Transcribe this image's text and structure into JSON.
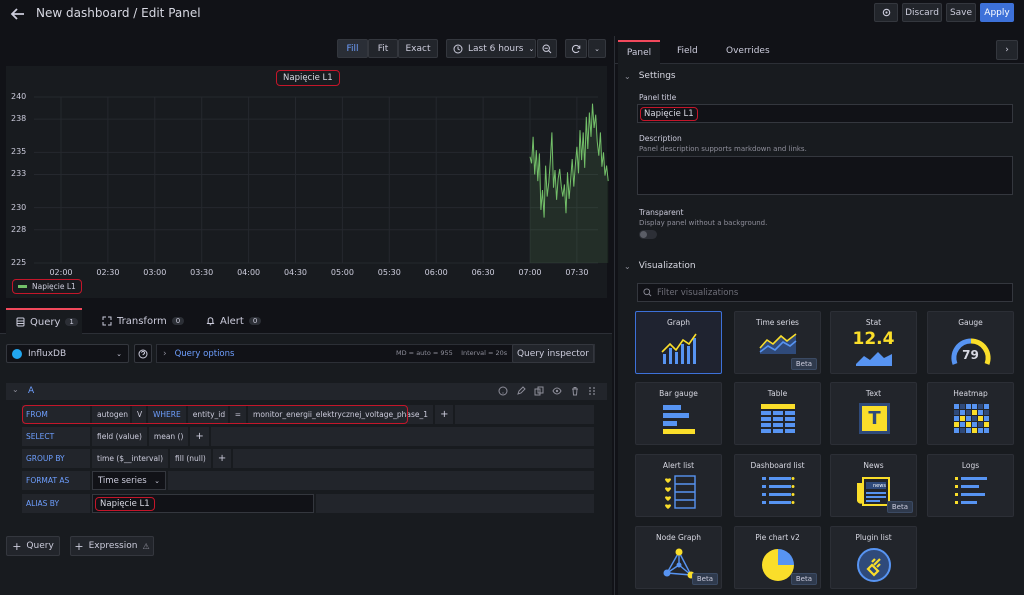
{
  "header": {
    "title": "New dashboard / Edit Panel",
    "discard": "Discard",
    "save": "Save",
    "apply": "Apply"
  },
  "toolbar": {
    "fill": "Fill",
    "fit": "Fit",
    "exact": "Exact",
    "time_range": "Last 6 hours"
  },
  "chart_data": {
    "type": "line",
    "title": "Napięcie L1",
    "yticks": [
      "240",
      "238",
      "235",
      "233",
      "230",
      "228",
      "225"
    ],
    "xticks": [
      "02:00",
      "02:30",
      "03:00",
      "03:30",
      "04:00",
      "04:30",
      "05:00",
      "05:30",
      "06:00",
      "06:30",
      "07:00",
      "07:30"
    ],
    "ylim": [
      225,
      240
    ],
    "legend_placement": "bottom-left",
    "series": [
      {
        "name": "Napięcie L1",
        "color": "#73bf69",
        "x": [
          "07:00",
          "07:01",
          "07:02",
          "07:03",
          "07:04",
          "07:05",
          "07:06",
          "07:07",
          "07:08",
          "07:09",
          "07:10",
          "07:11",
          "07:12",
          "07:13",
          "07:14",
          "07:15",
          "07:16",
          "07:17",
          "07:18",
          "07:19",
          "07:20",
          "07:21",
          "07:22",
          "07:23",
          "07:24",
          "07:25",
          "07:26",
          "07:27",
          "07:28",
          "07:29",
          "07:30",
          "07:31",
          "07:32",
          "07:33",
          "07:34",
          "07:35",
          "07:36",
          "07:37",
          "07:38",
          "07:39",
          "07:40",
          "07:41",
          "07:42",
          "07:43",
          "07:44",
          "07:45",
          "07:46",
          "07:47",
          "07:48",
          "07:49",
          "07:50"
        ],
        "y": [
          234.6,
          234.0,
          236.4,
          233.0,
          235.2,
          232.4,
          234.9,
          229.8,
          231.6,
          229.1,
          233.8,
          231.0,
          232.3,
          234.2,
          236.8,
          231.8,
          233.4,
          230.7,
          232.6,
          233.5,
          231.9,
          231.0,
          232.1,
          229.5,
          233.2,
          230.8,
          232.5,
          234.4,
          231.9,
          233.8,
          235.5,
          233.1,
          237.0,
          234.3,
          236.8,
          233.6,
          238.2,
          235.3,
          238.6,
          236.4,
          239.4,
          237.2,
          238.4,
          236.0,
          234.7,
          236.8,
          233.7,
          235.0,
          232.9,
          233.8,
          232.4
        ]
      }
    ]
  },
  "query_tabs": [
    {
      "label": "Query",
      "count": "1"
    },
    {
      "label": "Transform",
      "count": "0"
    },
    {
      "label": "Alert",
      "count": "0"
    }
  ],
  "datasource": {
    "name": "InfluxDB",
    "query_options": "Query options",
    "meta": "MD = auto = 955    Interval = 20s",
    "inspector": "Query inspector"
  },
  "query": {
    "ref": "A",
    "from_label": "FROM",
    "from_db": "autogen",
    "from_v": "V",
    "where_label": "WHERE",
    "where_key": "entity_id",
    "where_op": "=",
    "where_value": "monitor_energii_elektrycznej_voltage_phase_1",
    "select_label": "SELECT",
    "select_field": "field (value)",
    "select_mean": "mean ()",
    "group_label": "GROUP BY",
    "group_time": "time ($__interval)",
    "group_fill": "fill (null)",
    "format_label": "FORMAT AS",
    "format_value": "Time series",
    "alias_label": "ALIAS BY",
    "alias_value": "Napięcie L1"
  },
  "bottom_buttons": {
    "query": "Query",
    "expression": "Expression"
  },
  "right_tabs": [
    "Panel",
    "Field",
    "Overrides"
  ],
  "settings": {
    "header": "Settings",
    "panel_title_label": "Panel title",
    "panel_title_value": "Napięcie L1",
    "description_label": "Description",
    "description_sub": "Panel description supports markdown and links.",
    "transparent_label": "Transparent",
    "transparent_sub": "Display panel without a background."
  },
  "visualization": {
    "header": "Visualization",
    "filter_placeholder": "Filter visualizations",
    "cards": [
      {
        "label": "Graph",
        "beta": ""
      },
      {
        "label": "Time series",
        "beta": "Beta"
      },
      {
        "label": "Stat",
        "beta": "",
        "value": "12.4"
      },
      {
        "label": "Gauge",
        "beta": "",
        "value": "79"
      },
      {
        "label": "Bar gauge",
        "beta": ""
      },
      {
        "label": "Table",
        "beta": ""
      },
      {
        "label": "Text",
        "beta": "",
        "glyph": "T"
      },
      {
        "label": "Heatmap",
        "beta": ""
      },
      {
        "label": "Alert list",
        "beta": ""
      },
      {
        "label": "Dashboard list",
        "beta": ""
      },
      {
        "label": "News",
        "beta": "Beta",
        "glyph": "news"
      },
      {
        "label": "Logs",
        "beta": ""
      },
      {
        "label": "Node Graph",
        "beta": "Beta"
      },
      {
        "label": "Pie chart v2",
        "beta": "Beta"
      },
      {
        "label": "Plugin list",
        "beta": ""
      }
    ]
  },
  "colors": {
    "accent": "#3d71d9",
    "series": "#73bf69",
    "highlight": "#c4162a",
    "viz_blue": "#5794f2",
    "viz_yellow": "#fade2a"
  }
}
